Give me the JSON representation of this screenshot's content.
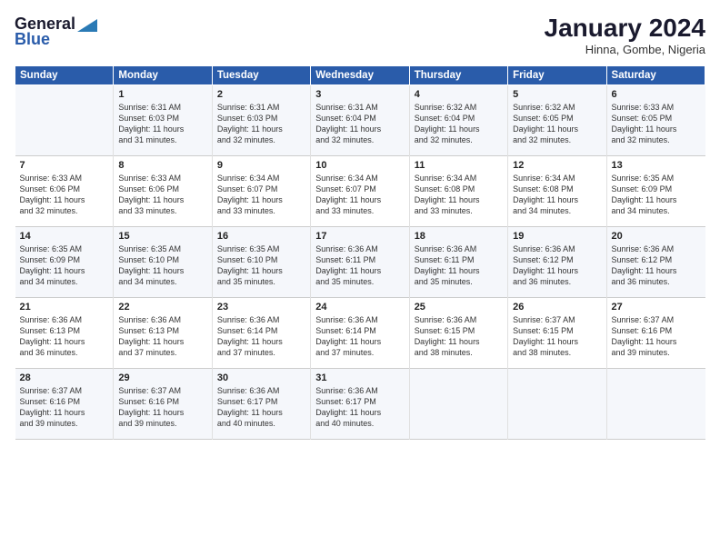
{
  "header": {
    "logo_general": "General",
    "logo_blue": "Blue",
    "month_title": "January 2024",
    "location": "Hinna, Gombe, Nigeria"
  },
  "weekdays": [
    "Sunday",
    "Monday",
    "Tuesday",
    "Wednesday",
    "Thursday",
    "Friday",
    "Saturday"
  ],
  "weeks": [
    [
      {
        "day": "",
        "content": ""
      },
      {
        "day": "1",
        "content": "Sunrise: 6:31 AM\nSunset: 6:03 PM\nDaylight: 11 hours\nand 31 minutes."
      },
      {
        "day": "2",
        "content": "Sunrise: 6:31 AM\nSunset: 6:03 PM\nDaylight: 11 hours\nand 32 minutes."
      },
      {
        "day": "3",
        "content": "Sunrise: 6:31 AM\nSunset: 6:04 PM\nDaylight: 11 hours\nand 32 minutes."
      },
      {
        "day": "4",
        "content": "Sunrise: 6:32 AM\nSunset: 6:04 PM\nDaylight: 11 hours\nand 32 minutes."
      },
      {
        "day": "5",
        "content": "Sunrise: 6:32 AM\nSunset: 6:05 PM\nDaylight: 11 hours\nand 32 minutes."
      },
      {
        "day": "6",
        "content": "Sunrise: 6:33 AM\nSunset: 6:05 PM\nDaylight: 11 hours\nand 32 minutes."
      }
    ],
    [
      {
        "day": "7",
        "content": "Sunrise: 6:33 AM\nSunset: 6:06 PM\nDaylight: 11 hours\nand 32 minutes."
      },
      {
        "day": "8",
        "content": "Sunrise: 6:33 AM\nSunset: 6:06 PM\nDaylight: 11 hours\nand 33 minutes."
      },
      {
        "day": "9",
        "content": "Sunrise: 6:34 AM\nSunset: 6:07 PM\nDaylight: 11 hours\nand 33 minutes."
      },
      {
        "day": "10",
        "content": "Sunrise: 6:34 AM\nSunset: 6:07 PM\nDaylight: 11 hours\nand 33 minutes."
      },
      {
        "day": "11",
        "content": "Sunrise: 6:34 AM\nSunset: 6:08 PM\nDaylight: 11 hours\nand 33 minutes."
      },
      {
        "day": "12",
        "content": "Sunrise: 6:34 AM\nSunset: 6:08 PM\nDaylight: 11 hours\nand 34 minutes."
      },
      {
        "day": "13",
        "content": "Sunrise: 6:35 AM\nSunset: 6:09 PM\nDaylight: 11 hours\nand 34 minutes."
      }
    ],
    [
      {
        "day": "14",
        "content": "Sunrise: 6:35 AM\nSunset: 6:09 PM\nDaylight: 11 hours\nand 34 minutes."
      },
      {
        "day": "15",
        "content": "Sunrise: 6:35 AM\nSunset: 6:10 PM\nDaylight: 11 hours\nand 34 minutes."
      },
      {
        "day": "16",
        "content": "Sunrise: 6:35 AM\nSunset: 6:10 PM\nDaylight: 11 hours\nand 35 minutes."
      },
      {
        "day": "17",
        "content": "Sunrise: 6:36 AM\nSunset: 6:11 PM\nDaylight: 11 hours\nand 35 minutes."
      },
      {
        "day": "18",
        "content": "Sunrise: 6:36 AM\nSunset: 6:11 PM\nDaylight: 11 hours\nand 35 minutes."
      },
      {
        "day": "19",
        "content": "Sunrise: 6:36 AM\nSunset: 6:12 PM\nDaylight: 11 hours\nand 36 minutes."
      },
      {
        "day": "20",
        "content": "Sunrise: 6:36 AM\nSunset: 6:12 PM\nDaylight: 11 hours\nand 36 minutes."
      }
    ],
    [
      {
        "day": "21",
        "content": "Sunrise: 6:36 AM\nSunset: 6:13 PM\nDaylight: 11 hours\nand 36 minutes."
      },
      {
        "day": "22",
        "content": "Sunrise: 6:36 AM\nSunset: 6:13 PM\nDaylight: 11 hours\nand 37 minutes."
      },
      {
        "day": "23",
        "content": "Sunrise: 6:36 AM\nSunset: 6:14 PM\nDaylight: 11 hours\nand 37 minutes."
      },
      {
        "day": "24",
        "content": "Sunrise: 6:36 AM\nSunset: 6:14 PM\nDaylight: 11 hours\nand 37 minutes."
      },
      {
        "day": "25",
        "content": "Sunrise: 6:36 AM\nSunset: 6:15 PM\nDaylight: 11 hours\nand 38 minutes."
      },
      {
        "day": "26",
        "content": "Sunrise: 6:37 AM\nSunset: 6:15 PM\nDaylight: 11 hours\nand 38 minutes."
      },
      {
        "day": "27",
        "content": "Sunrise: 6:37 AM\nSunset: 6:16 PM\nDaylight: 11 hours\nand 39 minutes."
      }
    ],
    [
      {
        "day": "28",
        "content": "Sunrise: 6:37 AM\nSunset: 6:16 PM\nDaylight: 11 hours\nand 39 minutes."
      },
      {
        "day": "29",
        "content": "Sunrise: 6:37 AM\nSunset: 6:16 PM\nDaylight: 11 hours\nand 39 minutes."
      },
      {
        "day": "30",
        "content": "Sunrise: 6:36 AM\nSunset: 6:17 PM\nDaylight: 11 hours\nand 40 minutes."
      },
      {
        "day": "31",
        "content": "Sunrise: 6:36 AM\nSunset: 6:17 PM\nDaylight: 11 hours\nand 40 minutes."
      },
      {
        "day": "",
        "content": ""
      },
      {
        "day": "",
        "content": ""
      },
      {
        "day": "",
        "content": ""
      }
    ]
  ]
}
